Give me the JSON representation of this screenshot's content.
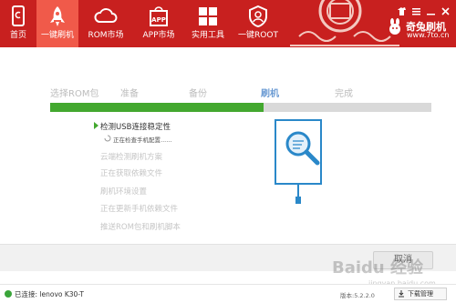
{
  "header": {
    "nav": [
      {
        "label": "首页",
        "icon": "home-phone-icon"
      },
      {
        "label": "一键刷机",
        "icon": "rocket-icon"
      },
      {
        "label": "ROM市场",
        "icon": "cloud-icon"
      },
      {
        "label": "APP市场",
        "icon": "app-bag-icon"
      },
      {
        "label": "实用工具",
        "icon": "grid-tools-icon"
      },
      {
        "label": "一键ROOT",
        "icon": "shield-icon"
      }
    ],
    "active_index": 1,
    "brand_name": "奇兔刷机",
    "brand_url": "www.7to.cn",
    "colors": {
      "bar": "#c8201f",
      "active": "#f05a4a"
    }
  },
  "steps": {
    "items": [
      "选择ROM包",
      "准备",
      "备份",
      "刷机",
      "完成"
    ],
    "active_index": 3,
    "progress_fraction": 0.56
  },
  "tasks": {
    "current": "检测USB连接稳定性",
    "current_sub": "正在检查手机配置......",
    "pending": [
      "云端检测刷机方案",
      "正在获取依赖文件",
      "刷机环境设置",
      "正在更新手机依赖文件",
      "推送ROM包和刷机脚本"
    ]
  },
  "actions": {
    "cancel_label": "取消"
  },
  "status": {
    "connection_text": "已连接: lenovo K30-T",
    "version": "版本:5.2.2.0",
    "download_manager": "下载管理"
  },
  "watermark": {
    "text": "Baidu 经验",
    "sub": "jingyan.baidu.com"
  }
}
